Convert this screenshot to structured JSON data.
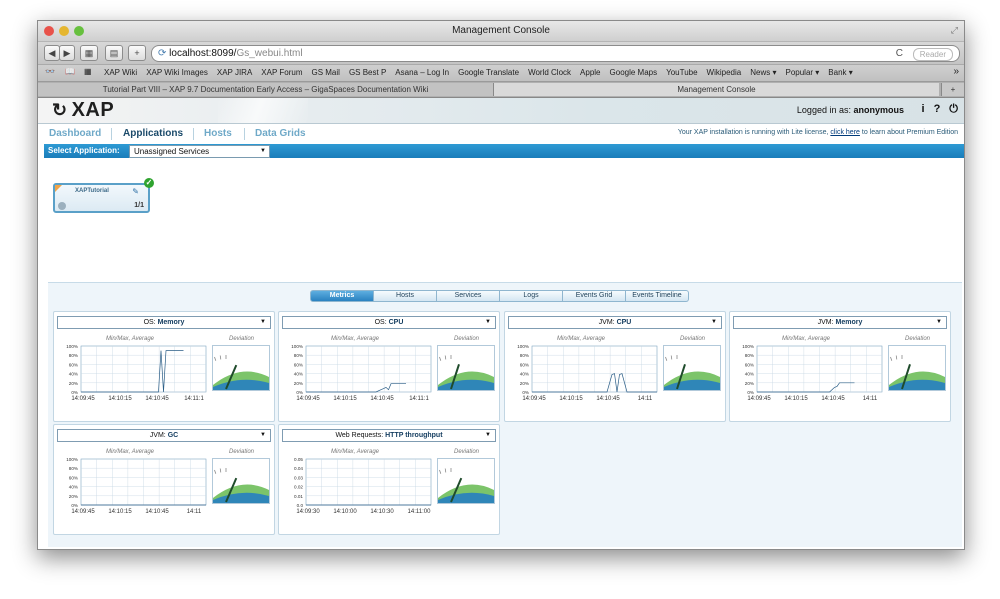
{
  "window": {
    "title": "Management Console",
    "lights": [
      "#e8524a",
      "#e5b630",
      "#67c03e"
    ]
  },
  "toolbar": {
    "back": "◀",
    "forward": "▶",
    "add": "+",
    "url_host": "localhost:8099/",
    "url_path": "Gs_webui.html",
    "reload": "C",
    "reader": "Reader"
  },
  "bookmarks": {
    "items": [
      "XAP Wiki",
      "XAP Wiki Images",
      "XAP JIRA",
      "XAP Forum",
      "GS Mail",
      "GS Best P",
      "Asana – Log In",
      "Google Translate",
      "World Clock",
      "Apple",
      "Google Maps",
      "YouTube",
      "Wikipedia",
      "News ▾",
      "Popular ▾",
      "Bank ▾"
    ],
    "more": "»"
  },
  "tabs": {
    "tab1": "Tutorial Part VIII – XAP 9.7 Documentation Early Access – GigaSpaces Documentation Wiki",
    "tab2": "Management Console",
    "new_tab": "+"
  },
  "header": {
    "logo": "XAP",
    "login_label": "Logged in as:",
    "user": "anonymous",
    "icons": [
      "i",
      "?",
      "⏻"
    ]
  },
  "nav": {
    "dashboard": "Dashboard",
    "applications": "Applications",
    "hosts": "Hosts",
    "data_grids": "Data Grids",
    "license_pre": "Your XAP installation is running with Lite license,",
    "license_link": "click here",
    "license_post": "to learn about Premium Edition"
  },
  "select_app": {
    "label": "Select Application:",
    "value": "Unassigned Services"
  },
  "service_card": {
    "name": "XAPTutorial",
    "count": "1/1"
  },
  "subtabs": [
    "Metrics",
    "Hosts",
    "Services",
    "Logs",
    "Events Grid",
    "Events Timeline"
  ],
  "panels": [
    {
      "prefix": "OS:",
      "metric": "Memory",
      "caption_left": "Min/Max, Average",
      "caption_right": "Deviation",
      "yticks": [
        "100%",
        "80%",
        "60%",
        "40%",
        "20%",
        "0%"
      ],
      "xticks": [
        "14:09:45",
        "14:10:15",
        "14:10:45",
        "14:11:1"
      ],
      "series_x": [
        0,
        0.5,
        0.62,
        0.64,
        0.66,
        0.68,
        0.72,
        0.82
      ],
      "series_y": [
        0,
        0,
        0,
        0.9,
        0,
        0.9,
        0.9,
        0.9
      ],
      "gauge": 0.18
    },
    {
      "prefix": "OS:",
      "metric": "CPU",
      "caption_left": "Min/Max, Average",
      "caption_right": "Deviation",
      "yticks": [
        "100%",
        "80%",
        "60%",
        "40%",
        "20%",
        "0%"
      ],
      "xticks": [
        "14:09:45",
        "14:10:15",
        "14:10:45",
        "14:11:1"
      ],
      "series_x": [
        0,
        0.56,
        0.6,
        0.64,
        0.66,
        0.68,
        0.72,
        0.8
      ],
      "series_y": [
        0,
        0,
        0.05,
        0.1,
        0.05,
        0.18,
        0.18,
        0.18
      ],
      "gauge": 0.15
    },
    {
      "prefix": "JVM:",
      "metric": "CPU",
      "caption_left": "Min/Max, Average",
      "caption_right": "Deviation",
      "yticks": [
        "100%",
        "80%",
        "60%",
        "40%",
        "20%",
        "0%"
      ],
      "xticks": [
        "14:09:45",
        "14:10:15",
        "14:10:45",
        "14:11"
      ],
      "series_x": [
        0,
        0.6,
        0.64,
        0.66,
        0.68,
        0.7,
        0.72,
        0.76,
        1
      ],
      "series_y": [
        0,
        0,
        0.38,
        0.4,
        0,
        0.38,
        0.4,
        0,
        0
      ],
      "gauge": 0.15
    },
    {
      "prefix": "JVM:",
      "metric": "Memory",
      "caption_left": "Min/Max, Average",
      "caption_right": "Deviation",
      "yticks": [
        "100%",
        "80%",
        "60%",
        "40%",
        "20%",
        "0%"
      ],
      "xticks": [
        "14:09:45",
        "14:10:15",
        "14:10:45",
        "14:11"
      ],
      "series_x": [
        0,
        0.58,
        0.62,
        0.64,
        0.66,
        0.7,
        0.78
      ],
      "series_y": [
        0,
        0,
        0.1,
        0.12,
        0.2,
        0.2,
        0.2
      ],
      "gauge": 0.15
    },
    {
      "prefix": "JVM:",
      "metric": "GC",
      "caption_left": "Min/Max, Average",
      "caption_right": "Deviation",
      "yticks": [
        "100%",
        "80%",
        "60%",
        "40%",
        "20%",
        "0%"
      ],
      "xticks": [
        "14:09:45",
        "14:10:15",
        "14:10:45",
        "14:11"
      ],
      "series_x": [
        0,
        1
      ],
      "series_y": [
        0,
        0
      ],
      "gauge": 0.18
    },
    {
      "prefix": "Web Requests:",
      "metric": "HTTP throughput",
      "caption_left": "Min/Max, Average",
      "caption_right": "Deviation",
      "yticks": [
        "0.05",
        "0.04",
        "0.03",
        "0.02",
        "0.01",
        "0.0"
      ],
      "xticks": [
        "14:09:30",
        "14:10:00",
        "14:10:30",
        "14:11:00"
      ],
      "series_x": [
        0,
        1
      ],
      "series_y": [
        0,
        0
      ],
      "gauge": 0.18
    }
  ]
}
